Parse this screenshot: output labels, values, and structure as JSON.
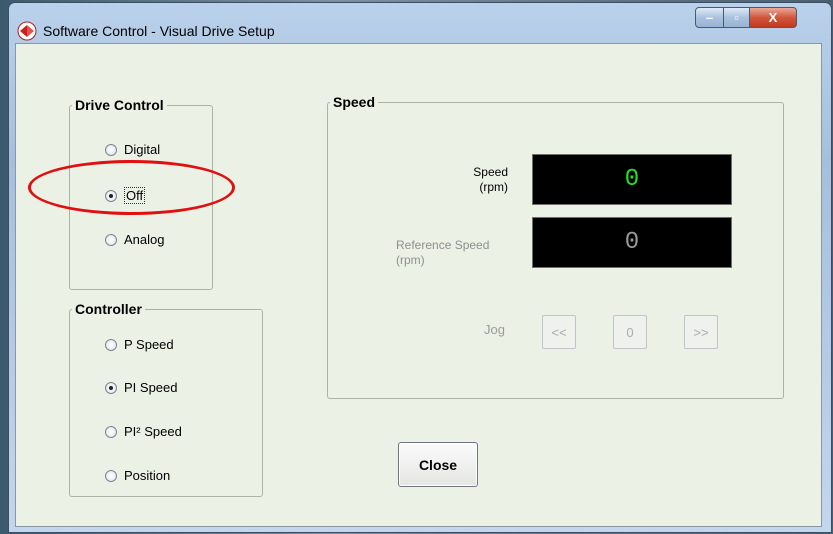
{
  "window": {
    "title": "Software Control - Visual Drive Setup",
    "minimize_glyph": "–",
    "maximize_glyph": "▫",
    "close_glyph": "X"
  },
  "drive_control": {
    "legend": "Drive Control",
    "options": [
      {
        "label": "Digital",
        "selected": false
      },
      {
        "label": "Off",
        "selected": true
      },
      {
        "label": "Analog",
        "selected": false
      }
    ]
  },
  "controller": {
    "legend": "Controller",
    "options": [
      {
        "label": "P Speed",
        "selected": false
      },
      {
        "label": "PI Speed",
        "selected": true
      },
      {
        "label": "PI² Speed",
        "selected": false
      },
      {
        "label": "Position",
        "selected": false
      }
    ]
  },
  "speed": {
    "legend": "Speed",
    "speed_label_line1": "Speed",
    "speed_label_line2": "(rpm)",
    "speed_value": "0",
    "ref_label_line1": "Reference Speed",
    "ref_label_line2": "(rpm)",
    "ref_value": "0",
    "jog_label": "Jog",
    "jog_back": "<<",
    "jog_zero": "0",
    "jog_forward": ">>"
  },
  "actions": {
    "close_label": "Close"
  },
  "colors": {
    "speed_readout": "#1ee42a",
    "reference_readout": "#9a9a9a",
    "annotation": "#e01010"
  },
  "icons": {
    "app": "app-logo-icon"
  }
}
